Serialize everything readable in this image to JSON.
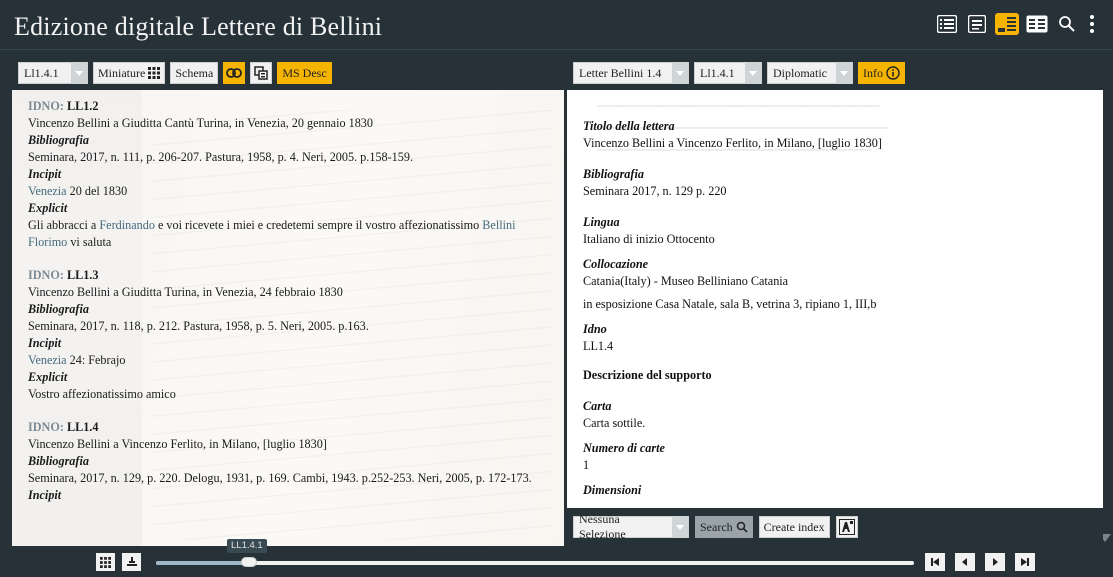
{
  "header": {
    "title": "Edizione digitale Lettere di Bellini",
    "icons": [
      "list-view-icon",
      "text-view-icon",
      "image-text-view-icon",
      "double-text-view-icon",
      "search-icon",
      "more-vert-icon"
    ]
  },
  "left_panel": {
    "page_select": "Ll1.4.1",
    "miniature_label": "Miniature",
    "schema_label": "Schema",
    "ms_desc_label": "MS Desc",
    "entries": [
      {
        "idno_label": "IDNO:",
        "idno": "LL1.2",
        "title": "Vincenzo Bellini a Giuditta Cantù Turina, in Venezia, 20 gennaio 1830",
        "bibliografia_label": "Bibliografia",
        "bibliografia": "Seminara, 2017, n. 111, p. 206-207. Pastura, 1958, p. 4. Neri, 2005. p.158-159.",
        "incipit_label": "Incipit",
        "incipit_link": "Venezia",
        "incipit_rest": " 20 del 1830",
        "explicit_label": "Explicit",
        "explicit_pre": "Gli abbracci a ",
        "explicit_link1": "Ferdinando",
        "explicit_mid": " e voi ricevete i miei e credetemi sempre il vostro affezionatissimo ",
        "explicit_link2": "Bellini Florimo",
        "explicit_post": " vi saluta"
      },
      {
        "idno_label": "IDNO:",
        "idno": "LL1.3",
        "title": "Vincenzo Bellini a Giuditta Turina, in Venezia, 24 febbraio 1830",
        "bibliografia_label": "Bibliografia",
        "bibliografia": "Seminara, 2017, n. 118, p. 212. Pastura, 1958, p. 5. Neri, 2005. p.163.",
        "incipit_label": "Incipit",
        "incipit_link": "Venezia",
        "incipit_rest": " 24: Febrajo",
        "explicit_label": "Explicit",
        "explicit_text": "Vostro affezionatissimo amico"
      },
      {
        "idno_label": "IDNO:",
        "idno": "LL1.4",
        "title": "Vincenzo Bellini a Vincenzo Ferlito, in Milano, [luglio 1830]",
        "bibliografia_label": "Bibliografia",
        "bibliografia": "Seminara, 2017, n. 129, p. 220. Delogu, 1931, p. 169. Cambi, 1943. p.252-253. Neri, 2005, p. 172-173.",
        "incipit_label": "Incipit"
      }
    ]
  },
  "right_panel": {
    "document_select": "Letter Bellini 1.4",
    "page_select": "Ll1.4.1",
    "edition_select": "Diplomatic",
    "info_label": "Info",
    "details": {
      "titolo_label": "Titolo della lettera",
      "titolo": "Vincenzo Bellini a Vincenzo Ferlito, in Milano, [luglio 1830]",
      "bibliografia_label": "Bibliografia",
      "bibliografia": "Seminara 2017, n. 129 p. 220",
      "lingua_label": "Lingua",
      "lingua": "Italiano di inizio Ottocento",
      "collocazione_label": "Collocazione",
      "collocazione_1": "Catania(Italy) - Museo Belliniano Catania",
      "collocazione_2": "in esposizione Casa Natale, sala B, vetrina 3, ripiano 1, III,b",
      "idno_label": "Idno",
      "idno": "LL1.4",
      "supporto_label": "Descrizione del supporto",
      "carta_label": "Carta",
      "carta": "Carta sottile.",
      "numero_label": "Numero di carte",
      "numero": "1",
      "dimensioni_label": "Dimensioni"
    },
    "bottom": {
      "selection": "Nessuna Selezione",
      "search_label": "Search",
      "create_index_label": "Create index"
    }
  },
  "footer": {
    "slider_tooltip": "LL1.4.1",
    "slider_position": 0.12
  },
  "colors": {
    "app_bg": "#263238",
    "accent": "#f4b400",
    "link": "#456a7e"
  }
}
